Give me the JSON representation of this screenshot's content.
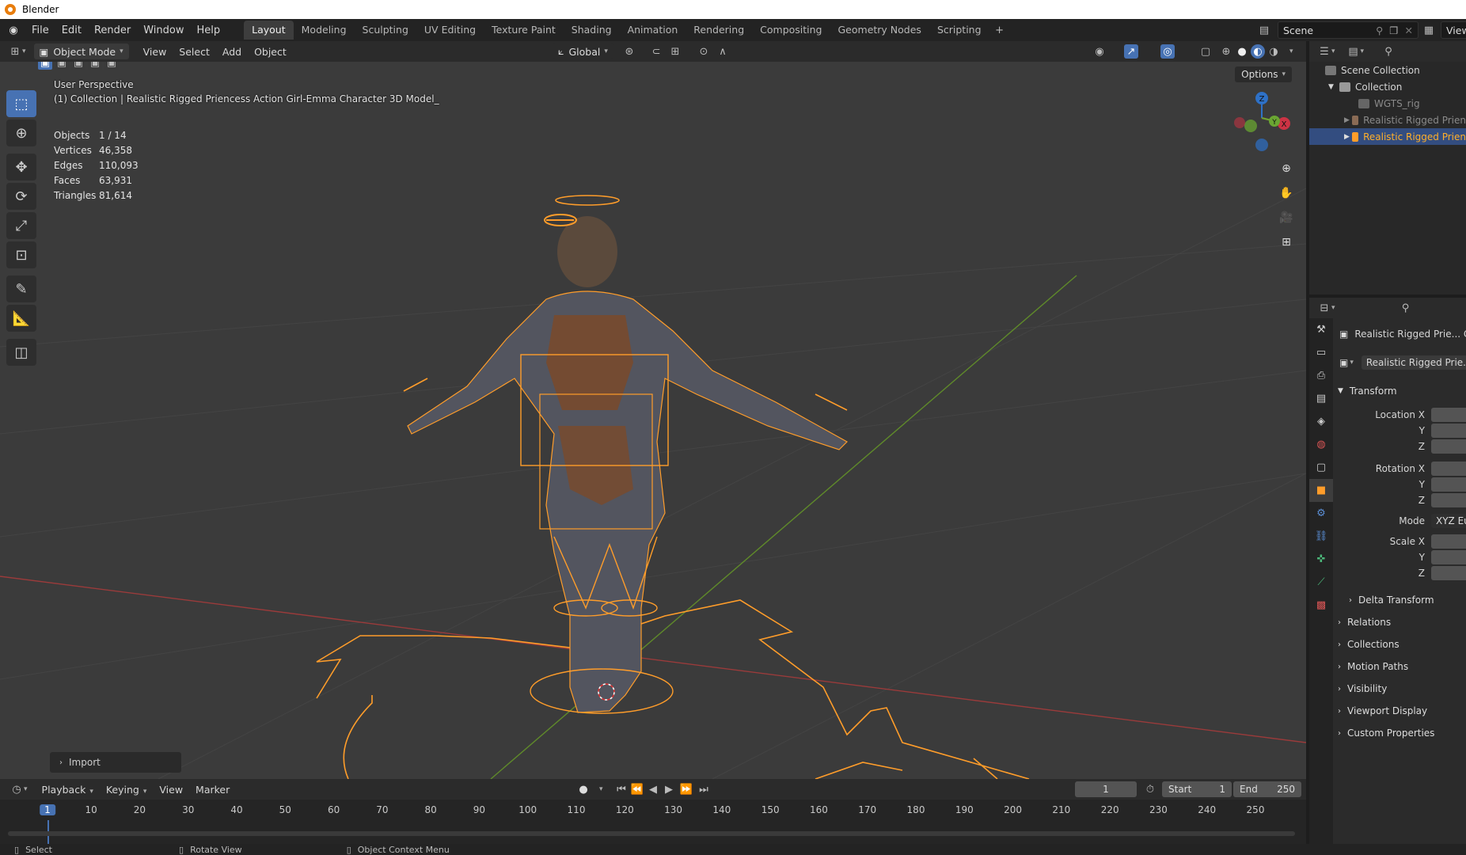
{
  "window": {
    "title": "Blender"
  },
  "menu": [
    "File",
    "Edit",
    "Render",
    "Window",
    "Help"
  ],
  "workspaces": [
    "Layout",
    "Modeling",
    "Sculpting",
    "UV Editing",
    "Texture Paint",
    "Shading",
    "Animation",
    "Rendering",
    "Compositing",
    "Geometry Nodes",
    "Scripting"
  ],
  "topright": {
    "scene": "Scene",
    "view_layer": "View"
  },
  "vp_header": {
    "mode": "Object Mode",
    "menus": [
      "View",
      "Select",
      "Add",
      "Object"
    ],
    "orientation": "Global",
    "options": "Options"
  },
  "viewport": {
    "perspective": "User Perspective",
    "collection_line": "(1) Collection | Realistic Rigged Priencess Action Girl-Emma Character 3D Model_",
    "stats": [
      {
        "label": "Objects",
        "value": "1 / 14"
      },
      {
        "label": "Vertices",
        "value": "46,358"
      },
      {
        "label": "Edges",
        "value": "110,093"
      },
      {
        "label": "Faces",
        "value": "63,931"
      },
      {
        "label": "Triangles",
        "value": "81,614"
      }
    ],
    "gizmo": {
      "z": "Z",
      "y": "Y",
      "x": "X"
    },
    "import_panel": "Import"
  },
  "outliner": {
    "scene_collection": "Scene Collection",
    "collection": "Collection",
    "items": [
      "WGTS_rig",
      "Realistic Rigged Prien",
      "Realistic Rigged Prien"
    ]
  },
  "properties": {
    "object_name": "Realistic Rigged Prie... Ch",
    "datablock": "Realistic Rigged Prie...C",
    "transform": "Transform",
    "location_x": "Location X",
    "rotation_x": "Rotation X",
    "mode_label": "Mode",
    "mode_value": "XYZ Eu",
    "scale_x": "Scale X",
    "axis_y": "Y",
    "axis_z": "Z",
    "sections": [
      "Delta Transform",
      "Relations",
      "Collections",
      "Motion Paths",
      "Visibility",
      "Viewport Display",
      "Custom Properties"
    ]
  },
  "timeline": {
    "menus": [
      "Playback",
      "Keying",
      "View",
      "Marker"
    ],
    "current_frame": "1",
    "start_label": "Start",
    "start": "1",
    "end_label": "End",
    "end": "250",
    "ticks": [
      "1",
      "10",
      "20",
      "30",
      "40",
      "50",
      "60",
      "70",
      "80",
      "90",
      "100",
      "110",
      "120",
      "130",
      "140",
      "150",
      "160",
      "170",
      "180",
      "190",
      "200",
      "210",
      "220",
      "230",
      "240",
      "250"
    ]
  },
  "statusbar": {
    "select": "Select",
    "rotate": "Rotate View",
    "context": "Object Context Menu"
  },
  "colors": {
    "accent": "#4772b3",
    "selection_orange": "#ffa126",
    "viewport_bg": "#3b3b3b"
  }
}
